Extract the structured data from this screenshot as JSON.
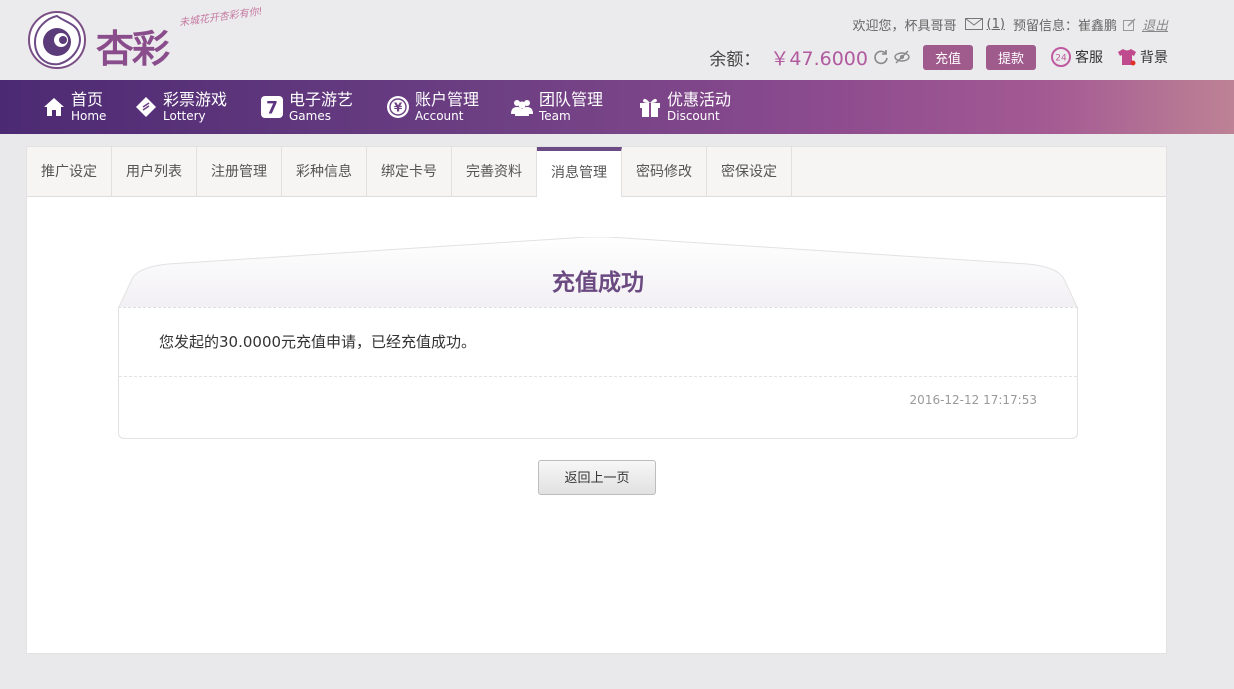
{
  "brand": {
    "name": "杏彩",
    "slogan": "未城花开杏彩有你!"
  },
  "topbar": {
    "welcome": "欢迎您，",
    "username": "杯具哥哥",
    "mail_count": "(1)",
    "reserved_label": "预留信息：",
    "reserved_value": "崔鑫鹏",
    "logout": "退出"
  },
  "account_bar": {
    "balance_label": "余额：",
    "balance_value": "￥47.6000",
    "recharge_button": "充值",
    "withdraw_button": "提款",
    "service": "客服",
    "background": "背景"
  },
  "nav": {
    "items": [
      {
        "zh": "首页",
        "en": "Home",
        "icon": "home-icon"
      },
      {
        "zh": "彩票游戏",
        "en": "Lottery",
        "icon": "ticket-icon"
      },
      {
        "zh": "电子游艺",
        "en": "Games",
        "icon": "seven-icon"
      },
      {
        "zh": "账户管理",
        "en": "Account",
        "icon": "yen-coin-icon"
      },
      {
        "zh": "团队管理",
        "en": "Team",
        "icon": "users-icon"
      },
      {
        "zh": "优惠活动",
        "en": "Discount",
        "icon": "gift-icon"
      }
    ]
  },
  "tabs": {
    "items": [
      "推广设定",
      "用户列表",
      "注册管理",
      "彩种信息",
      "绑定卡号",
      "完善资料",
      "消息管理",
      "密码修改",
      "密保设定"
    ],
    "active": "消息管理"
  },
  "message": {
    "title": "充值成功",
    "body": "您发起的30.0000元充值申请，已经充值成功。",
    "timestamp": "2016-12-12 17:17:53"
  },
  "actions": {
    "back_button": "返回上一页"
  },
  "colors": {
    "accent": "#a05b8d",
    "nav_start": "#4c2a73",
    "nav_end": "#bd8295",
    "title": "#6b4a82"
  }
}
